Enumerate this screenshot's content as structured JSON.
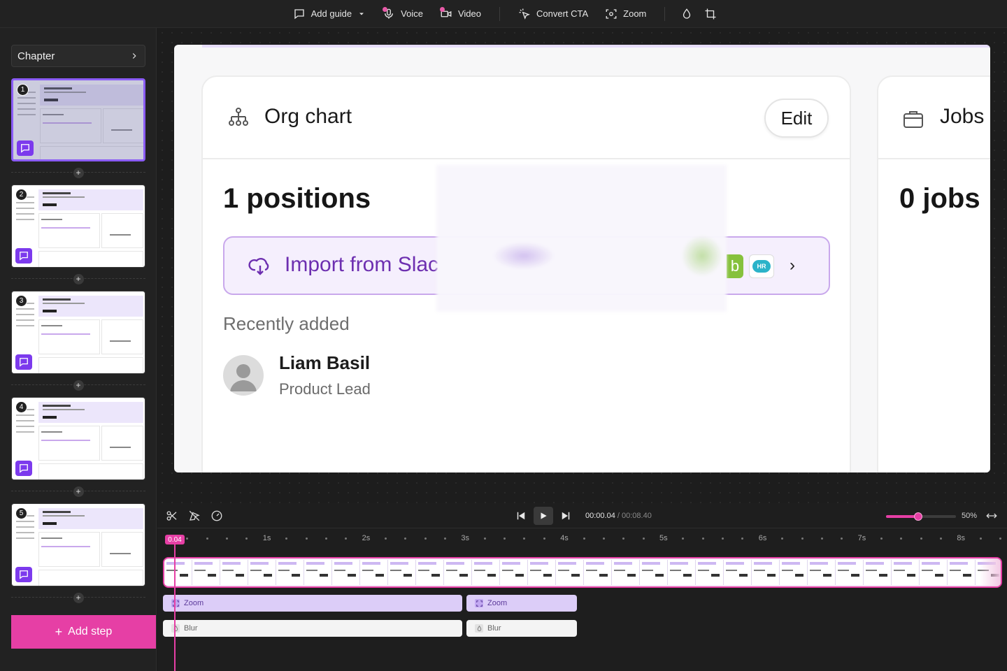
{
  "toolbar": {
    "add_guide": "Add guide",
    "voice": "Voice",
    "video": "Video",
    "convert_cta": "Convert CTA",
    "zoom": "Zoom"
  },
  "sidebar": {
    "chapter": "Chapter",
    "steps": [
      {
        "number": "1"
      },
      {
        "number": "2"
      },
      {
        "number": "3"
      },
      {
        "number": "4"
      },
      {
        "number": "5"
      }
    ],
    "add_step": "Add step"
  },
  "canvas": {
    "org_card": {
      "title": "Org chart",
      "edit": "Edit",
      "positions": "1 positions",
      "import_text": "Import from Slack",
      "recently_added": "Recently added",
      "person": {
        "name": "Liam Basil",
        "role": "Product Lead"
      }
    },
    "jobs_card": {
      "title": "Jobs",
      "count": "0 jobs"
    }
  },
  "timeline": {
    "current_time": "00:00.04",
    "total_time": "/ 00:08.40",
    "zoom_percent": "50%",
    "zoom_slider_value": 0.46,
    "playhead_label": "0.04",
    "ruler_labels": [
      "1s",
      "2s",
      "3s",
      "4s",
      "5s",
      "6s",
      "7s",
      "8s"
    ],
    "segments": {
      "zoom1": "Zoom",
      "zoom2": "Zoom",
      "blur1": "Blur",
      "blur2": "Blur"
    }
  },
  "colors": {
    "accent": "#e63fa5",
    "purple": "#7c3aed"
  }
}
